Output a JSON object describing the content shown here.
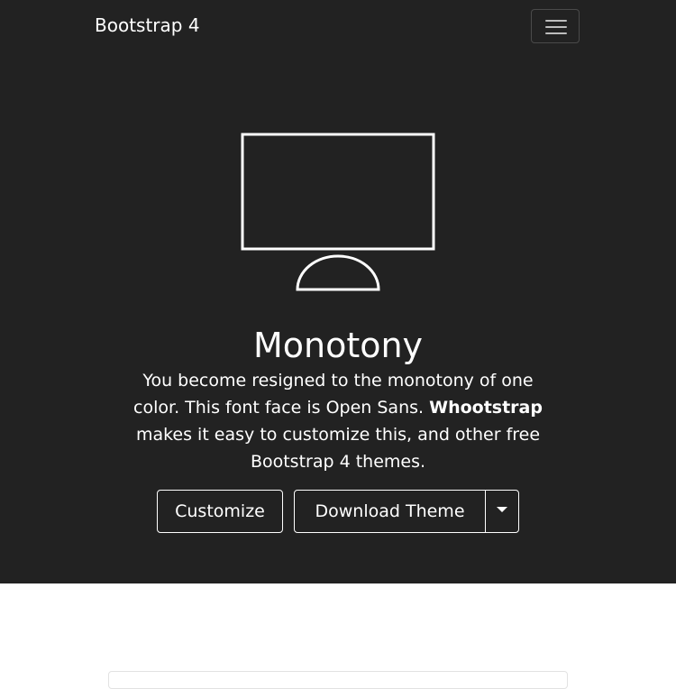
{
  "navbar": {
    "brand": "Bootstrap 4",
    "toggler_icon": "hamburger-menu-icon"
  },
  "hero": {
    "icon": "monitor-icon",
    "title": "Monotony",
    "lead_text_1": "You become resigned to the monotony of one color. This font face is Open Sans. ",
    "lead_bold": "Whootstrap",
    "lead_text_2": " makes it easy to customize this, and other free Bootstrap 4 themes.",
    "buttons": {
      "customize": "Customize",
      "download": "Download Theme",
      "dropdown_icon": "caret-down-icon"
    }
  },
  "colors": {
    "hero_background": "#222222",
    "text": "#ffffff",
    "page_background": "#ffffff"
  }
}
